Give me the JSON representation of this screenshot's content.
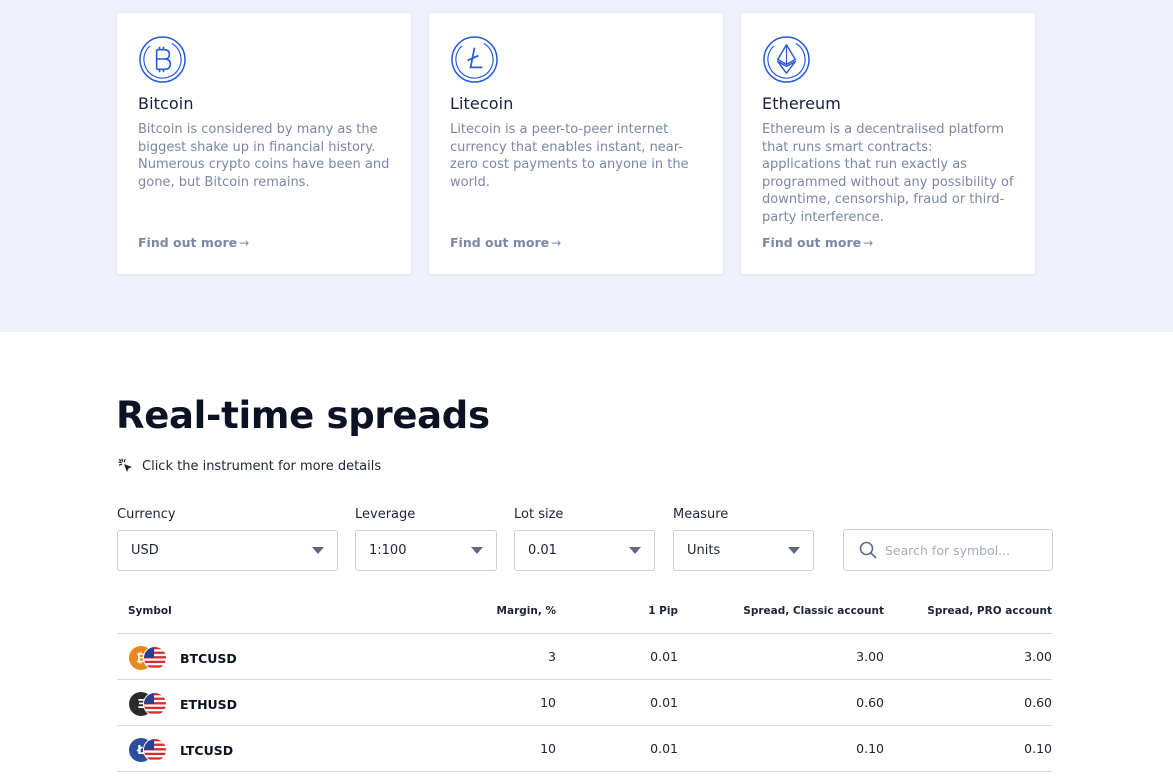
{
  "cards": [
    {
      "title": "Bitcoin",
      "text": "Bitcoin is considered by many as the biggest shake up in financial history. Numerous crypto coins have been and gone, but Bitcoin remains.",
      "link": "Find out more",
      "icon": "bitcoin-icon"
    },
    {
      "title": "Litecoin",
      "text": "Litecoin is a peer-to-peer internet currency that enables instant, near-zero cost payments to anyone in the world.",
      "link": "Find out more",
      "icon": "litecoin-icon"
    },
    {
      "title": "Ethereum",
      "text": "Ethereum is a decentralised platform that runs smart contracts: applications that run exactly as programmed without any possibility of downtime, censorship, fraud or third-party interference.",
      "link": "Find out more",
      "icon": "ethereum-icon"
    }
  ],
  "spreads": {
    "title": "Real-time spreads",
    "hint": "Click the instrument for more details",
    "filters": {
      "currency": {
        "label": "Currency",
        "value": "USD"
      },
      "leverage": {
        "label": "Leverage",
        "value": "1:100"
      },
      "lot_size": {
        "label": "Lot size",
        "value": "0.01"
      },
      "measure": {
        "label": "Measure",
        "value": "Units"
      }
    },
    "search": {
      "placeholder": "Search for symbol..."
    },
    "columns": [
      "Symbol",
      "Margin, %",
      "1 Pip",
      "Spread, Classic account",
      "Spread, PRO account"
    ],
    "rows": [
      {
        "symbol": "BTCUSD",
        "margin": "3",
        "pip": "0.01",
        "classic": "3.00",
        "pro": "3.00",
        "coin_color": "#e8891c",
        "coin_glyph": "₿"
      },
      {
        "symbol": "ETHUSD",
        "margin": "10",
        "pip": "0.01",
        "classic": "0.60",
        "pro": "0.60",
        "coin_color": "#2b2b2b",
        "coin_glyph": "Ξ"
      },
      {
        "symbol": "LTCUSD",
        "margin": "10",
        "pip": "0.01",
        "classic": "0.10",
        "pro": "0.10",
        "coin_color": "#2d4e9c",
        "coin_glyph": "Ł"
      }
    ]
  },
  "colors": {
    "accent": "#2a5bd7",
    "band": "#eef1f9",
    "muted_text": "#7b87a3"
  }
}
